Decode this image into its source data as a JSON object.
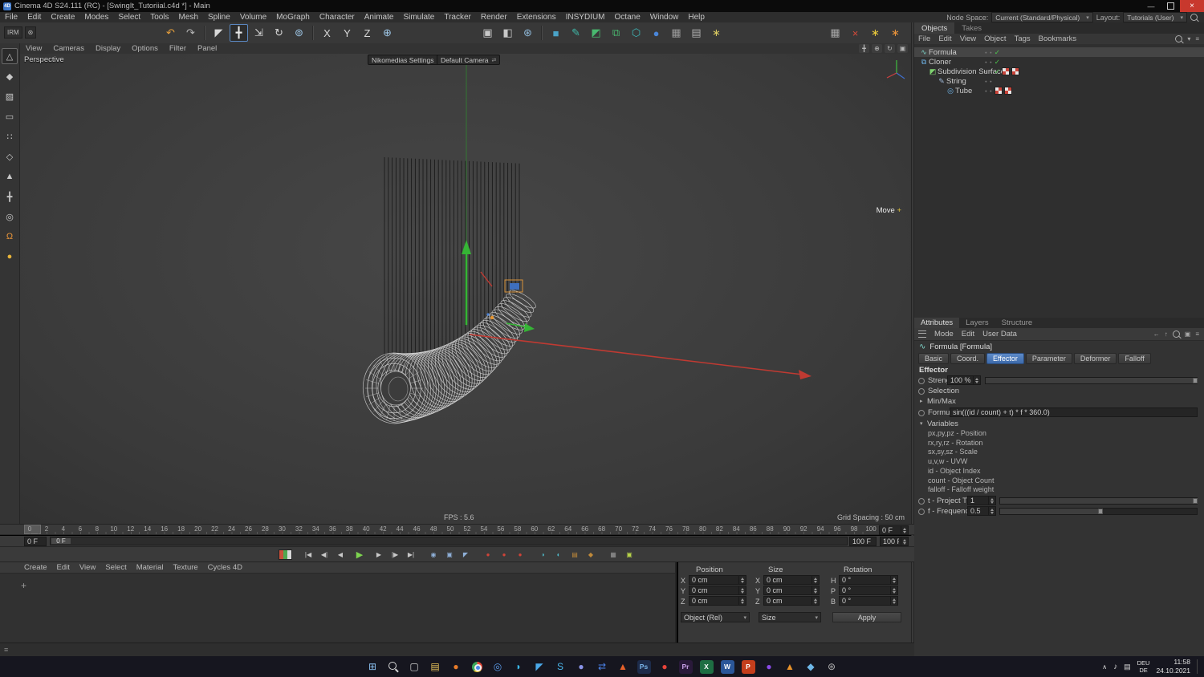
{
  "titlebar": {
    "title": "Cinema 4D S24.111 (RC) - [SwingIt_Tutoriial.c4d *] - Main",
    "minimize": "—",
    "close": "×",
    "app_icon": "4D"
  },
  "menubar": {
    "items": [
      "File",
      "Edit",
      "Create",
      "Modes",
      "Select",
      "Tools",
      "Mesh",
      "Spline",
      "Volume",
      "MoGraph",
      "Character",
      "Animate",
      "Simulate",
      "Tracker",
      "Render",
      "Extensions",
      "INSYDIUM",
      "Octane",
      "Window",
      "Help"
    ],
    "node_space_label": "Node Space:",
    "node_space_value": "Current (Standard/Physical)",
    "layout_label": "Layout:",
    "layout_value": "Tutorials (User)"
  },
  "toolbar": {
    "irm_label": "IRM",
    "left": [
      {
        "name": "undo-icon",
        "glyph": "↶",
        "fg": "#e8a03c"
      },
      {
        "name": "redo-icon",
        "glyph": "↷",
        "fg": "#b8b8b8"
      },
      {
        "sep": true
      },
      {
        "name": "live-selection-icon",
        "glyph": "◤",
        "fg": "#d8d8d8"
      },
      {
        "name": "move-icon",
        "glyph": "╋",
        "fg": "#e8e8e8",
        "active": true
      },
      {
        "name": "scale-icon",
        "glyph": "⇲",
        "fg": "#d8d8d8"
      },
      {
        "name": "rotate-icon",
        "glyph": "↻",
        "fg": "#d8d8d8"
      },
      {
        "name": "last-tool-icon",
        "glyph": "⊚",
        "fg": "#9fc8e8"
      },
      {
        "sep": true
      },
      {
        "name": "lock-x-button",
        "glyph": "X",
        "fg": "#d8d8d8"
      },
      {
        "name": "lock-y-button",
        "glyph": "Y",
        "fg": "#d8d8d8"
      },
      {
        "name": "lock-z-button",
        "glyph": "Z",
        "fg": "#d8d8d8"
      },
      {
        "name": "coord-system-icon",
        "glyph": "⊕",
        "fg": "#9fc8e8"
      }
    ],
    "mid": [
      {
        "name": "render-view-icon",
        "glyph": "▣",
        "fg": "#c8c8c8"
      },
      {
        "name": "render-pv-icon",
        "glyph": "◧",
        "fg": "#c8c8c8"
      },
      {
        "name": "render-settings-icon",
        "glyph": "⊛",
        "fg": "#8fb9d9"
      },
      {
        "sep": true
      },
      {
        "name": "primitive-cube-icon",
        "glyph": "■",
        "fg": "#4aa3c7"
      },
      {
        "name": "spline-pen-icon",
        "glyph": "✎",
        "fg": "#3fb8a8"
      },
      {
        "name": "generators-icon",
        "glyph": "◩",
        "fg": "#49b96f"
      },
      {
        "name": "cloner-tool-icon",
        "glyph": "⧉",
        "fg": "#49b96f"
      },
      {
        "name": "volume-tool-icon",
        "glyph": "⬡",
        "fg": "#3fb8b8"
      },
      {
        "name": "dynamics-icon",
        "glyph": "●",
        "fg": "#4a86d8"
      },
      {
        "name": "fields-icon",
        "glyph": "▦",
        "fg": "#9a9a9a"
      },
      {
        "name": "camera-tool-icon",
        "glyph": "▤",
        "fg": "#b0b0b0"
      },
      {
        "name": "light-tool-icon",
        "glyph": "∗",
        "fg": "#d8c860"
      }
    ],
    "right": [
      {
        "name": "plugin-grid-icon",
        "glyph": "▦",
        "fg": "#a8a8a8"
      },
      {
        "name": "plugin-red-icon",
        "glyph": "×",
        "fg": "#d84a3a"
      },
      {
        "name": "plugin-yellow-icon",
        "glyph": "∗",
        "fg": "#e8c83a"
      },
      {
        "name": "plugin-orange-icon",
        "glyph": "∗",
        "fg": "#e8923a"
      }
    ]
  },
  "left_toolbar": [
    {
      "name": "make-editable-icon",
      "glyph": "△",
      "fg": "#c8c8c8",
      "active": true
    },
    {
      "name": "model-mode-icon",
      "glyph": "◆",
      "fg": "#c8c8c8"
    },
    {
      "name": "texture-mode-icon",
      "glyph": "▨",
      "fg": "#c8c8c8"
    },
    {
      "name": "workplane-icon",
      "glyph": "▭",
      "fg": "#c8c8c8"
    },
    {
      "name": "points-mode-icon",
      "glyph": "∷",
      "fg": "#c8c8c8"
    },
    {
      "name": "edges-mode-icon",
      "glyph": "◇",
      "fg": "#c8c8c8"
    },
    {
      "name": "polygons-mode-icon",
      "glyph": "▲",
      "fg": "#c8c8c8"
    },
    {
      "name": "axis-mode-icon",
      "glyph": "╋",
      "fg": "#c8c8c8"
    },
    {
      "name": "solo-mode-icon",
      "glyph": "◎",
      "fg": "#c8c8c8"
    },
    {
      "name": "snap-icon",
      "glyph": "Ω",
      "fg": "#e8953a"
    },
    {
      "name": "bodypaint-icon",
      "glyph": "●",
      "fg": "#e8b43a"
    }
  ],
  "viewport": {
    "menu": [
      "View",
      "Cameras",
      "Display",
      "Options",
      "Filter",
      "Panel"
    ],
    "label": "Perspective",
    "settings_chip": "Nikomedias Settings",
    "camera_chip": "Default Camera",
    "tool_hint": "Move",
    "tool_hint_plus": "+",
    "fps": "FPS : 5.6",
    "grid": "Grid Spacing : 50 cm"
  },
  "objects": {
    "tabs": [
      {
        "label": "Objects",
        "active": true
      },
      {
        "label": "Takes",
        "active": false
      }
    ],
    "menu": [
      "File",
      "Edit",
      "View",
      "Object",
      "Tags",
      "Bookmarks"
    ],
    "tree": [
      {
        "label": "Formula",
        "depth": 0,
        "icon": "formula-effector-icon",
        "glyph": "∿",
        "color": "#7fd4c8",
        "selected": true,
        "check": true,
        "tags": 0
      },
      {
        "label": "Cloner",
        "depth": 0,
        "icon": "cloner-icon",
        "glyph": "⧉",
        "color": "#6fb4e8",
        "selected": false,
        "check": true,
        "tags": 0
      },
      {
        "label": "Subdivision Surface",
        "depth": 1,
        "icon": "subdivision-surface-icon",
        "glyph": "◩",
        "color": "#7fd470",
        "selected": false,
        "check": true,
        "tags": 2
      },
      {
        "label": "String",
        "depth": 2,
        "icon": "spline-icon",
        "glyph": "✎",
        "color": "#9fb8d8",
        "selected": false,
        "check": false,
        "tags": 0
      },
      {
        "label": "Tube",
        "depth": 3,
        "icon": "tube-icon",
        "glyph": "◎",
        "color": "#6fb4e8",
        "selected": false,
        "check": false,
        "tags": 2
      }
    ]
  },
  "attributes": {
    "tabs": [
      {
        "label": "Attributes",
        "active": true
      },
      {
        "label": "Layers",
        "active": false
      },
      {
        "label": "Structure",
        "active": false
      }
    ],
    "mode_items": [
      "Mode",
      "Edit",
      "User Data"
    ],
    "title": "Formula [Formula]",
    "section_tabs": [
      {
        "label": "Basic",
        "active": false
      },
      {
        "label": "Coord.",
        "active": false
      },
      {
        "label": "Effector",
        "active": true
      },
      {
        "label": "Parameter",
        "active": false
      },
      {
        "label": "Deformer",
        "active": false
      },
      {
        "label": "Falloff",
        "active": false
      }
    ],
    "section_title": "Effector",
    "rows": {
      "strength": {
        "label": "Strength",
        "value": "100 %",
        "slider": 1
      },
      "selection": {
        "label": "Selection"
      },
      "minmax": {
        "label": "Min/Max"
      },
      "formula": {
        "label": "Formula",
        "value": "sin(((id / count) + t) * f * 360.0)"
      },
      "variables": {
        "label": "Variables",
        "lines": [
          "px,py,pz - Position",
          "rx,ry,rz - Rotation",
          "sx,sy,sz - Scale",
          "u,v,w - UVW",
          "id - Object Index",
          "count - Object Count",
          "falloff - Falloff weight"
        ]
      },
      "t": {
        "label": "t - Project Time",
        "value": "1",
        "slider": 1
      },
      "f": {
        "label": "f - Frequency",
        "value": "0.5",
        "slider": 0.52
      }
    }
  },
  "timeline": {
    "ticks": [
      0,
      2,
      4,
      6,
      8,
      10,
      12,
      14,
      16,
      18,
      20,
      22,
      24,
      26,
      28,
      30,
      32,
      34,
      36,
      38,
      40,
      42,
      44,
      46,
      48,
      50,
      52,
      54,
      56,
      58,
      60,
      62,
      64,
      66,
      68,
      70,
      72,
      74,
      76,
      78,
      80,
      82,
      84,
      86,
      88,
      90,
      92,
      94,
      96,
      98,
      100
    ],
    "current_frame": "0 F",
    "range_start": "0 F",
    "playhead_chip": "0 F",
    "range_end": "100 F",
    "max_frame": "100 F"
  },
  "animation": {
    "icons": [
      {
        "name": "timeline-palette-icon",
        "cls": "palette"
      },
      {
        "gap": true
      },
      {
        "name": "goto-start-button",
        "glyph": "|◀"
      },
      {
        "name": "prev-key-button",
        "glyph": "◀|"
      },
      {
        "name": "prev-frame-button",
        "glyph": "◀"
      },
      {
        "name": "play-button",
        "glyph": "▶",
        "fg": "#7dd44f",
        "big": true
      },
      {
        "name": "next-frame-button",
        "glyph": "▶"
      },
      {
        "name": "next-key-button",
        "glyph": "|▶"
      },
      {
        "name": "goto-end-button",
        "glyph": "▶|"
      },
      {
        "gap": true
      },
      {
        "name": "record-button",
        "glyph": "◉",
        "fg": "#8fb0d8"
      },
      {
        "name": "autokey-button",
        "glyph": "▣",
        "fg": "#8fb0d8"
      },
      {
        "name": "record-selection-button",
        "glyph": "◤",
        "fg": "#8fb0d8"
      },
      {
        "gap": true
      },
      {
        "name": "key-position-button",
        "glyph": "●",
        "fg": "#cf4338"
      },
      {
        "name": "key-scale-button",
        "glyph": "●",
        "fg": "#cf4338"
      },
      {
        "name": "key-rotation-button",
        "glyph": "●",
        "fg": "#cf4338"
      },
      {
        "gap": true
      },
      {
        "name": "key-parameter-button",
        "glyph": "◑",
        "fg": "#4fb8c8"
      },
      {
        "name": "key-pla-button",
        "glyph": "◐",
        "fg": "#4fb8c8"
      },
      {
        "name": "keyframe-bar-icon",
        "glyph": "▤",
        "fg": "#c08a3a"
      },
      {
        "name": "motion-mode-icon",
        "glyph": "◆",
        "fg": "#c08a3a"
      },
      {
        "gap": true
      },
      {
        "name": "timeline-grid-icon",
        "glyph": "▦",
        "fg": "#9a9a9a"
      },
      {
        "name": "preview-range-icon",
        "glyph": "▣",
        "fg": "#b8d44a"
      }
    ]
  },
  "bottom": {
    "menu": [
      "Create",
      "Edit",
      "View",
      "Select",
      "Material",
      "Texture",
      "Cycles 4D"
    ],
    "add_label": "+"
  },
  "coords": {
    "headers": {
      "position": "Position",
      "size": "Size",
      "rotation": "Rotation"
    },
    "position": [
      [
        "X",
        "0 cm"
      ],
      [
        "Y",
        "0 cm"
      ],
      [
        "Z",
        "0 cm"
      ]
    ],
    "size": [
      [
        "X",
        "0 cm"
      ],
      [
        "Y",
        "0 cm"
      ],
      [
        "Z",
        "0 cm"
      ]
    ],
    "rotation": [
      [
        "H",
        "0 °"
      ],
      [
        "P",
        "0 °"
      ],
      [
        "B",
        "0 °"
      ]
    ],
    "object_mode": "Object (Rel)",
    "size_mode": "Size",
    "apply": "Apply"
  },
  "statusbar": {
    "grip": "≡"
  },
  "taskbar": {
    "time": "11:58",
    "date": "24.10.2021",
    "lang_top": "DEU",
    "lang_bottom": "DE",
    "icons": [
      {
        "name": "start-button",
        "glyph": "⊞",
        "fg": "#8ac0f0"
      },
      {
        "name": "search-button",
        "cls": "magbig"
      },
      {
        "name": "task-view-button",
        "glyph": "▢",
        "fg": "#d0d0d0"
      },
      {
        "name": "file-explorer-icon",
        "glyph": "▤",
        "fg": "#e8c35a"
      },
      {
        "name": "firefox-icon",
        "glyph": "●",
        "fg": "#e87c2a"
      },
      {
        "name": "chrome-icon",
        "cls": "chromeball"
      },
      {
        "name": "safari-icon",
        "glyph": "◎",
        "fg": "#5a9ae8"
      },
      {
        "name": "edge-icon",
        "glyph": "◗",
        "fg": "#3ab8e8"
      },
      {
        "name": "telegram-icon",
        "glyph": "◤",
        "fg": "#4aa8e8"
      },
      {
        "name": "skype-icon",
        "glyph": "S",
        "fg": "#4ab4e8"
      },
      {
        "name": "discord-icon",
        "glyph": "●",
        "fg": "#8a94e8"
      },
      {
        "name": "teamviewer-icon",
        "glyph": "⇄",
        "fg": "#4a82e8"
      },
      {
        "name": "brave-icon",
        "glyph": "▲",
        "fg": "#e8622a"
      },
      {
        "name": "photoshop-icon",
        "glyph": "Ps",
        "cls": "tile",
        "fg": "#7ab4e8",
        "bg": "#1d2b4a"
      },
      {
        "name": "opera-icon",
        "glyph": "●",
        "fg": "#e8443a"
      },
      {
        "name": "premiere-icon",
        "glyph": "Pr",
        "cls": "tile",
        "fg": "#c9a0e8",
        "bg": "#2a1a3a"
      },
      {
        "name": "excel-icon",
        "glyph": "X",
        "cls": "tile",
        "fg": "#ffffff",
        "bg": "#1e6e43"
      },
      {
        "name": "word-icon",
        "glyph": "W",
        "cls": "tile",
        "fg": "#ffffff",
        "bg": "#2a5699"
      },
      {
        "name": "powerpoint-icon",
        "glyph": "P",
        "cls": "tile",
        "fg": "#ffffff",
        "bg": "#c43e1c"
      },
      {
        "name": "purple-app-icon",
        "glyph": "●",
        "fg": "#8a4ae8"
      },
      {
        "name": "vlc-icon",
        "glyph": "▲",
        "fg": "#e8922a"
      },
      {
        "name": "cinema4d-icon",
        "glyph": "◆",
        "fg": "#6fb8e8"
      },
      {
        "name": "settings-icon",
        "glyph": "⊛",
        "fg": "#b0b0b0"
      }
    ]
  }
}
